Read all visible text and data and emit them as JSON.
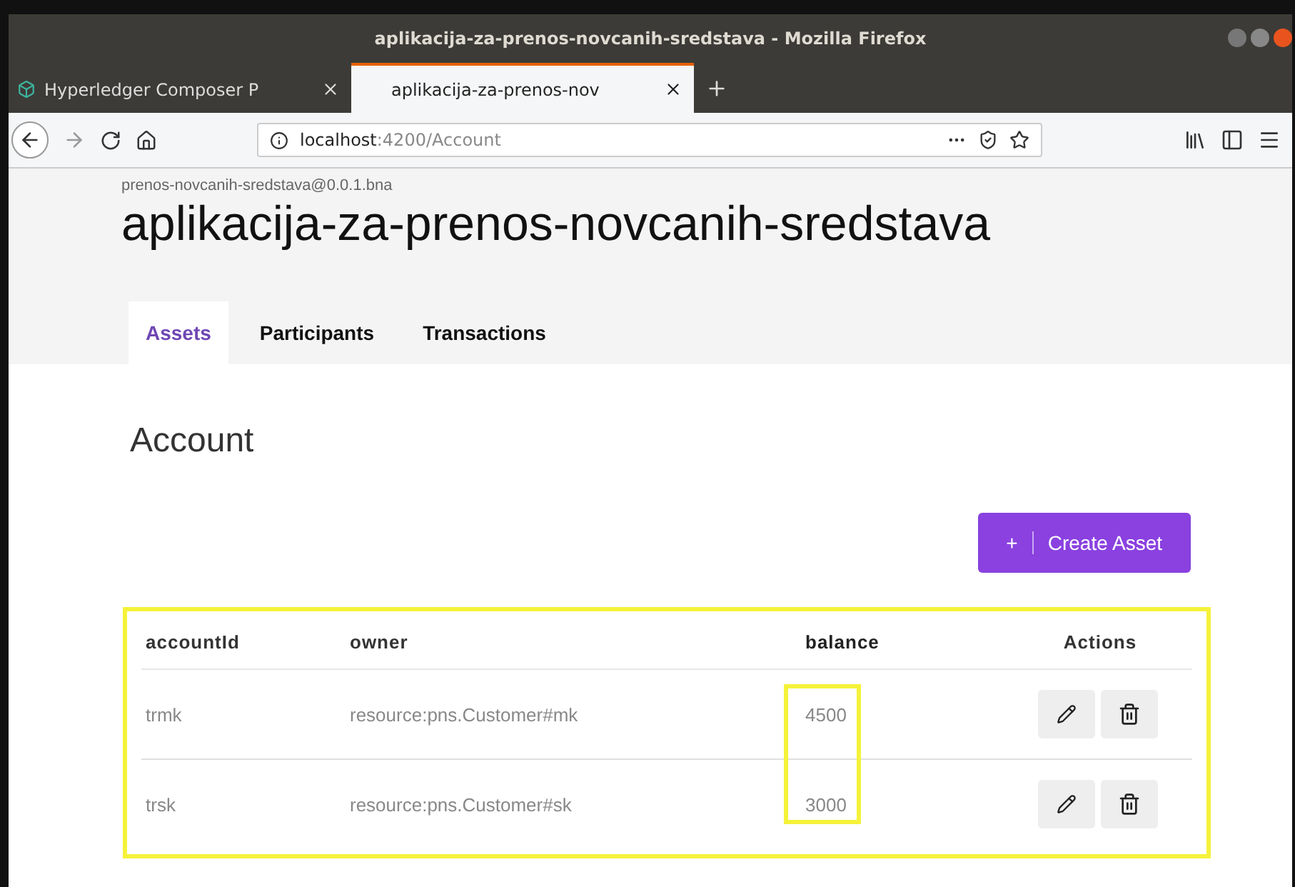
{
  "window": {
    "title": "aplikacija-za-prenos-novcanih-sredstava - Mozilla Firefox"
  },
  "browser_tabs": [
    {
      "label": "Hyperledger Composer P",
      "selected": false
    },
    {
      "label": "aplikacija-za-prenos-nov",
      "selected": true
    }
  ],
  "address_bar": {
    "host": "localhost",
    "path": ":4200/Account"
  },
  "header": {
    "subtitle": "prenos-novcanih-sredstava@0.0.1.bna",
    "title": "aplikacija-za-prenos-novcanih-sredstava"
  },
  "tabs": [
    {
      "label": "Assets",
      "selected": true
    },
    {
      "label": "Participants",
      "selected": false
    },
    {
      "label": "Transactions",
      "selected": false
    }
  ],
  "page_title": "Account",
  "create_button": {
    "icon": "+",
    "label": "Create Asset"
  },
  "table": {
    "highlighted": true,
    "columns": [
      {
        "label": "accountId",
        "highlighted": false
      },
      {
        "label": "owner",
        "highlighted": false
      },
      {
        "label": "balance",
        "highlighted": true
      },
      {
        "label": "Actions",
        "highlighted": false
      }
    ],
    "rows": [
      {
        "cells": [
          "trmk",
          "resource:pns.Customer#mk",
          "4500"
        ]
      },
      {
        "cells": [
          "trsk",
          "resource:pns.Customer#sk",
          "3000"
        ]
      }
    ]
  }
}
